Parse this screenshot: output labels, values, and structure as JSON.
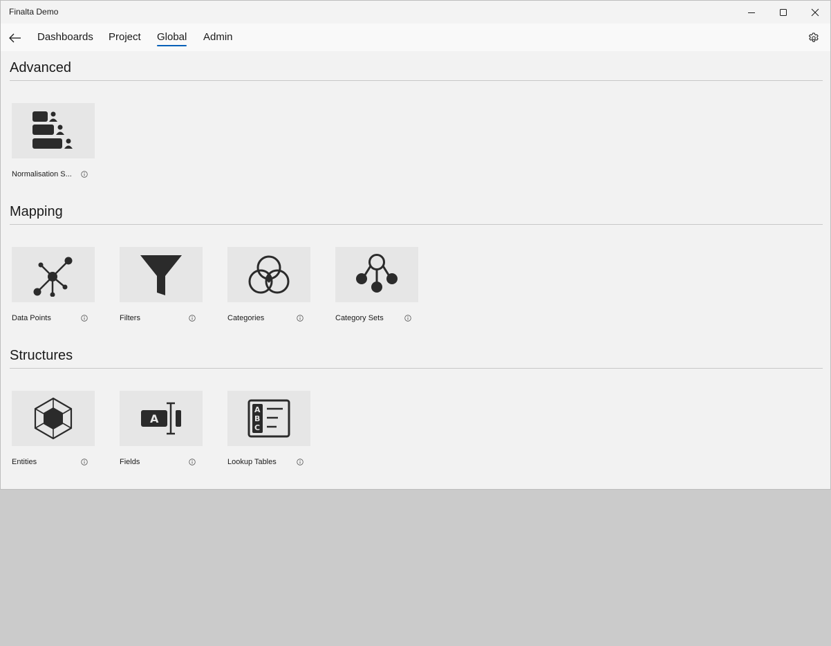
{
  "window": {
    "title": "Finalta Demo"
  },
  "nav": {
    "tabs": [
      {
        "label": "Dashboards"
      },
      {
        "label": "Project"
      },
      {
        "label": "Global"
      },
      {
        "label": "Admin"
      }
    ],
    "active_tab": "Global"
  },
  "sections": [
    {
      "title": "Advanced",
      "tiles": [
        {
          "label": "Normalisation S...",
          "icon": "normalisation-icon"
        }
      ]
    },
    {
      "title": "Mapping",
      "tiles": [
        {
          "label": "Data Points",
          "icon": "data-points-icon"
        },
        {
          "label": "Filters",
          "icon": "filter-funnel-icon"
        },
        {
          "label": "Categories",
          "icon": "venn-categories-icon"
        },
        {
          "label": "Category Sets",
          "icon": "hierarchy-icon"
        }
      ]
    },
    {
      "title": "Structures",
      "tiles": [
        {
          "label": "Entities",
          "icon": "hexagon-cube-icon"
        },
        {
          "label": "Fields",
          "icon": "text-field-icon"
        },
        {
          "label": "Lookup Tables",
          "icon": "abc-list-icon"
        }
      ]
    }
  ],
  "colors": {
    "accent": "#005fb8",
    "icon": "#2b2b2b",
    "tile_bg": "#e6e6e6",
    "page_bg": "#f2f2f2",
    "desktop_bg": "#cbcbcb"
  }
}
